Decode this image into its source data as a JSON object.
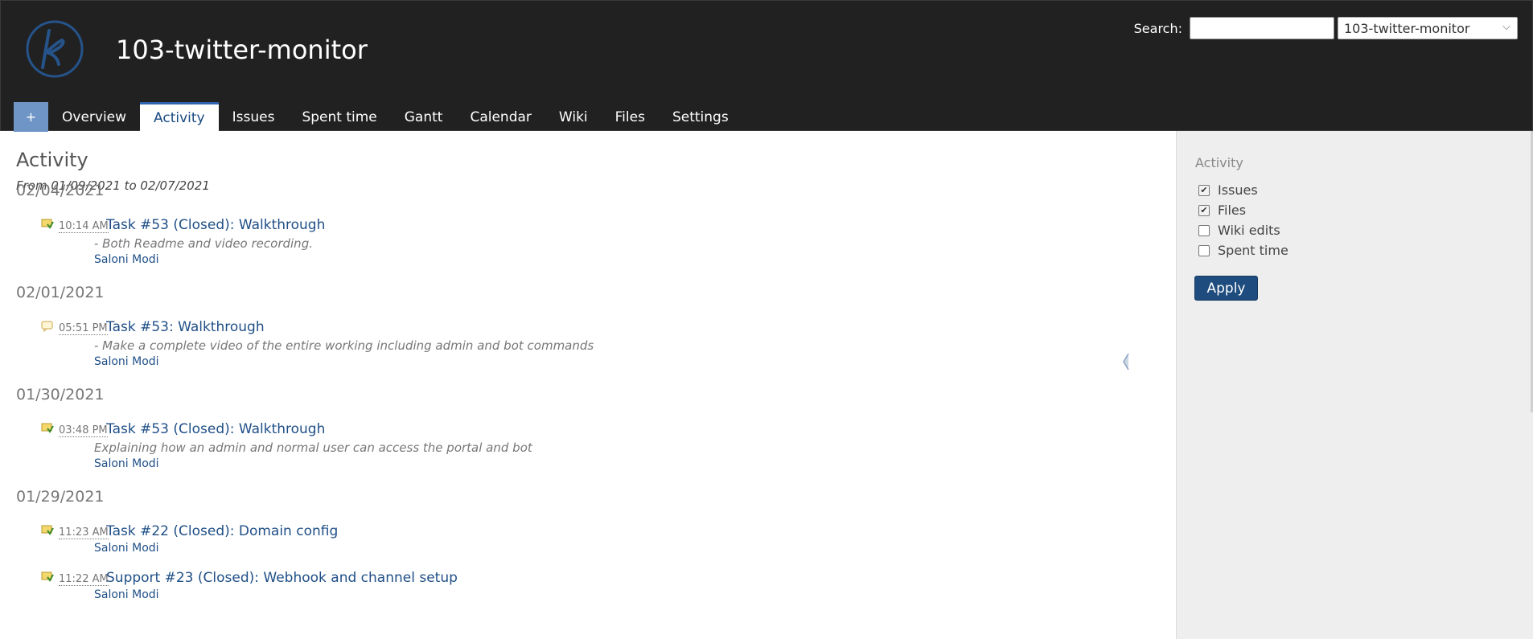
{
  "header": {
    "project_title": "103-twitter-monitor",
    "search_label": "Search:",
    "search_value": "",
    "project_jump_selected": "103-twitter-monitor"
  },
  "menu": {
    "new_object": "+",
    "items": [
      {
        "label": "Overview"
      },
      {
        "label": "Activity",
        "selected": true
      },
      {
        "label": "Issues"
      },
      {
        "label": "Spent time"
      },
      {
        "label": "Gantt"
      },
      {
        "label": "Calendar"
      },
      {
        "label": "Wiki"
      },
      {
        "label": "Files"
      },
      {
        "label": "Settings"
      }
    ]
  },
  "content": {
    "heading": "Activity",
    "date_range": "From 01/09/2021 to 02/07/2021",
    "days": [
      {
        "date": "02/04/2021",
        "events": [
          {
            "icon": "issue-closed-icon",
            "time": "10:14 AM",
            "title": "Task #53 (Closed): Walkthrough",
            "description": "- Both Readme and video recording.",
            "author": "Saloni Modi"
          }
        ]
      },
      {
        "date": "02/01/2021",
        "events": [
          {
            "icon": "issue-note-icon",
            "time": "05:51 PM",
            "title": "Task #53: Walkthrough",
            "description": "- Make a complete video of the entire working including admin and bot commands",
            "author": "Saloni Modi"
          }
        ]
      },
      {
        "date": "01/30/2021",
        "events": [
          {
            "icon": "issue-closed-icon",
            "time": "03:48 PM",
            "title": "Task #53 (Closed): Walkthrough",
            "description": "Explaining how an admin and normal user can access the portal and bot",
            "author": "Saloni Modi"
          }
        ]
      },
      {
        "date": "01/29/2021",
        "events": [
          {
            "icon": "issue-closed-icon",
            "time": "11:23 AM",
            "title": "Task #22 (Closed): Domain config",
            "description": "",
            "author": "Saloni Modi"
          },
          {
            "icon": "issue-closed-icon",
            "time": "11:22 AM",
            "title": "Support #23 (Closed): Webhook and channel setup",
            "description": "",
            "author": "Saloni Modi"
          }
        ]
      }
    ]
  },
  "sidebar": {
    "heading": "Activity",
    "filters": [
      {
        "label": "Issues",
        "checked": true
      },
      {
        "label": "Files",
        "checked": true
      },
      {
        "label": "Wiki edits",
        "checked": false
      },
      {
        "label": "Spent time",
        "checked": false
      }
    ],
    "apply_label": "Apply"
  },
  "colors": {
    "header_bg": "#212121",
    "link": "#1f4f87",
    "apply_button": "#1e4c7e",
    "new_object_button": "#6f95c6",
    "sidebar_bg": "#eeeeee"
  }
}
